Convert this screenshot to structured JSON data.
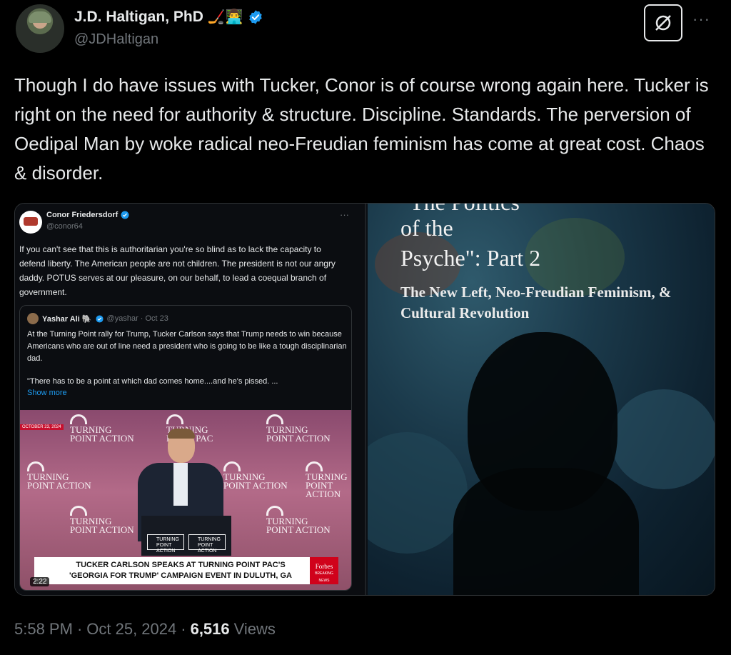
{
  "author": {
    "display_name": "J.D. Haltigan, PhD",
    "emoji": "🏒👨‍💻",
    "handle": "@JDHaltigan",
    "verified": true
  },
  "tweet": {
    "text": "Though I do have issues with Tucker, Conor is of course wrong again here. Tucker is right on the need for authority & structure. Discipline. Standards. The perversion of Oedipal Man by woke radical neo-Freudian feminism has come at great cost. Chaos & disorder."
  },
  "quoted_screenshot": {
    "name": "Conor Friedersdorf",
    "handle": "@conor64",
    "text": "If you can't see that this is authoritarian you're so blind as to lack the capacity to defend liberty. The American people are not children. The president is not our angry daddy. POTUS serves at our pleasure, on our behalf, to lead a coequal branch of government.",
    "inner": {
      "name": "Yashar Ali 🐘",
      "handle": "@yashar · Oct 23",
      "text": "At the Turning Point rally for Trump, Tucker Carlson says that Trump needs to win because Americans who are out of line need a president who is going to be like a tough disciplinarian dad.",
      "quote": "\"There has to be a point at which dad comes home....and he's pissed. ...",
      "show_more": "Show more",
      "video": {
        "logo_line1": "TURNING",
        "logo_line2": "POINT ACTION",
        "logo_alt": "POINT PAC",
        "date_chip": "OCTOBER 23, 2024",
        "banner": "TUCKER CARLSON SPEAKS AT TURNING POINT PAC'S 'GEORGIA FOR TRUMP' CAMPAIGN EVENT IN DULUTH, GA",
        "forbes": "Forbes",
        "forbes_sub": "BREAKING NEWS",
        "duration": "2:22"
      }
    }
  },
  "art": {
    "title_top": "\"The Politics",
    "title_line1": "of the",
    "title_line2": "Psyche\": Part 2",
    "subtitle": "The New Left, Neo-Freudian Feminism, & Cultural Revolution"
  },
  "meta": {
    "time": "5:58 PM",
    "separator": "·",
    "date": "Oct 25, 2024",
    "separator2": "·",
    "views_count": "6,516",
    "views_label": "Views"
  },
  "colors": {
    "background": "#000000",
    "text": "#e7e9ea",
    "muted": "#71767b",
    "accent": "#1d9bf0"
  }
}
